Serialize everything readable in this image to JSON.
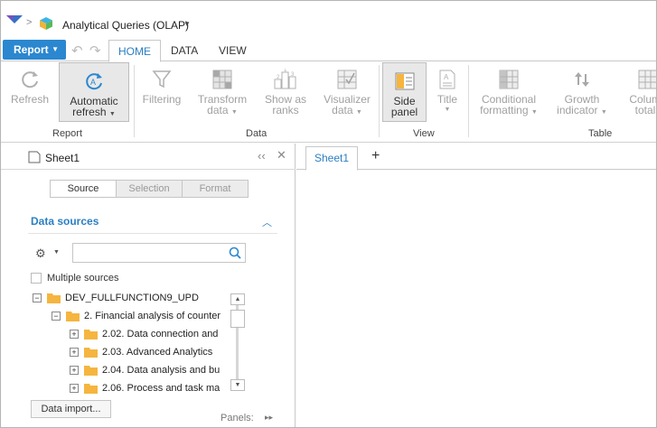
{
  "app": {
    "title": "Analytical Queries (OLAP)",
    "breadcrumb_sep": ">"
  },
  "toolbar": {
    "report_label": "Report"
  },
  "tabs": [
    "HOME",
    "DATA",
    "VIEW"
  ],
  "ribbon": {
    "refresh": "Refresh",
    "auto_refresh_1": "Automatic",
    "auto_refresh_2": "refresh",
    "filtering": "Filtering",
    "transform_1": "Transform",
    "transform_2": "data",
    "show_ranks_1": "Show as",
    "show_ranks_2": "ranks",
    "visualizer_1": "Visualizer",
    "visualizer_2": "data",
    "side_panel_1": "Side",
    "side_panel_2": "panel",
    "title": "Title",
    "conditional_1": "Conditional",
    "conditional_2": "formatting",
    "growth_1": "Growth",
    "growth_2": "indicator",
    "column_totals_1": "Column",
    "column_totals_2": "totals",
    "groups": {
      "report": "Report",
      "data": "Data",
      "view": "View",
      "table": "Table"
    }
  },
  "panel": {
    "sheet_name": "Sheet1",
    "segments": [
      "Source",
      "Selection",
      "Format"
    ],
    "data_sources_title": "Data sources",
    "search_placeholder": "",
    "multiple_sources": "Multiple sources",
    "tree": [
      "DEV_FULLFUNCTION9_UPD",
      "2. Financial analysis of counter",
      "2.02. Data connection and",
      "2.03. Advanced Analytics",
      "2.04. Data analysis and bu",
      "2.06. Process and task ma"
    ],
    "data_import": "Data import...",
    "panels_label": "Panels:"
  },
  "main": {
    "sheet_tab": "Sheet1",
    "add_tab": "+"
  },
  "colors": {
    "accent": "#2b87cf",
    "link": "#2b7fc2",
    "folder": "#f5b53f"
  }
}
